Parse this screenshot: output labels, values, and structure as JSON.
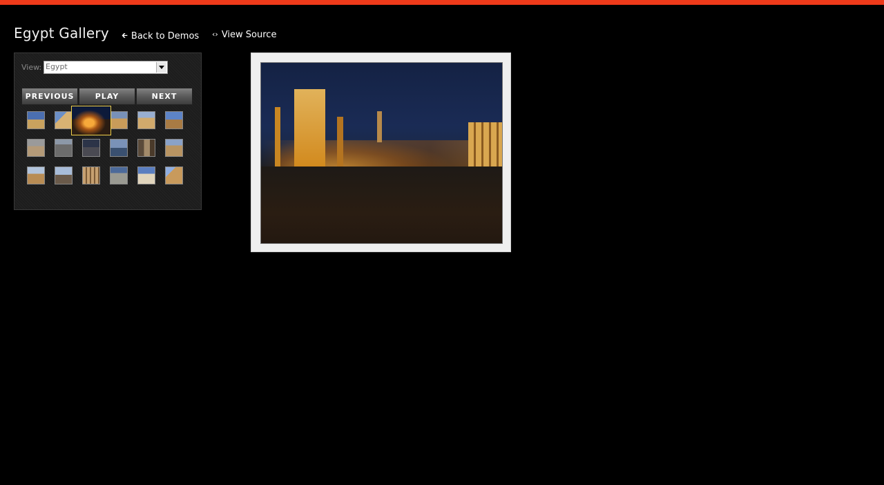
{
  "header": {
    "title": "Egypt Gallery",
    "back_link": "Back to Demos",
    "back_icon": "arrow-left-icon",
    "source_link": "View Source",
    "source_icon": "code-brackets-icon"
  },
  "colors": {
    "accent_bar": "#ee3a1a",
    "active_thumb_border": "#f2d14a"
  },
  "panel": {
    "view_label": "View:",
    "view_select_value": "Egypt",
    "buttons": {
      "previous": "PREVIOUS",
      "play": "PLAY",
      "next": "NEXT"
    },
    "thumbnail_count": 18,
    "active_thumbnail_index": 2
  }
}
